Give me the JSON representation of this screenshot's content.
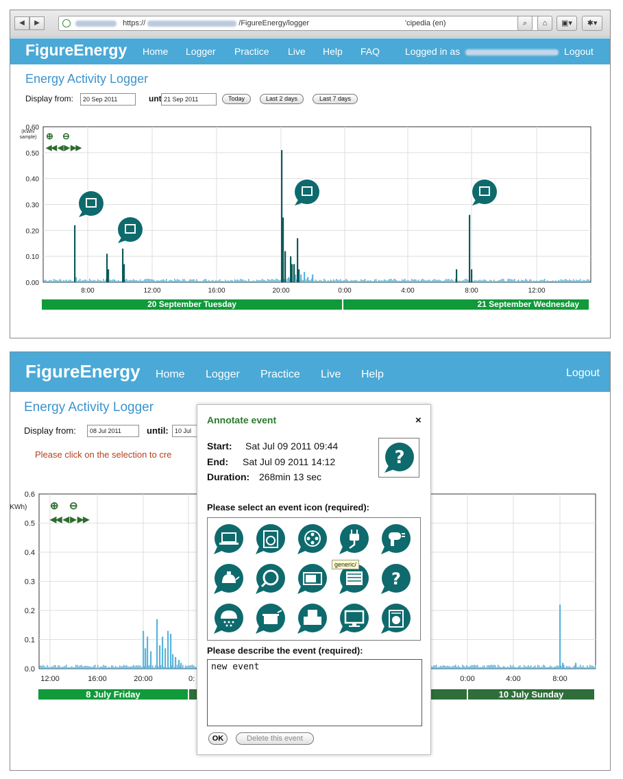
{
  "browser": {
    "url_prefix": "https://",
    "url_path": "/FigureEnergy/logger",
    "search_engine": "'cipedia (en)"
  },
  "site": {
    "brand": "FigureEnergy",
    "nav_top": [
      "Home",
      "Logger",
      "Practice",
      "Live",
      "Help",
      "FAQ"
    ],
    "nav_bottom": [
      "Home",
      "Logger",
      "Practice",
      "Live",
      "Help"
    ],
    "logged_in_prefix": "Logged in as",
    "logout": "Logout",
    "page_title": "Energy Activity Logger",
    "display_from_label": "Display from:",
    "until_label": "until:",
    "colors": {
      "header": "#4aa9d6",
      "title": "#3d93cc",
      "chart_dark": "#0c5a5a",
      "chart_light": "#5ab4dc",
      "day_band_active": "#109a3a",
      "day_band_inactive": "#2f6e3a",
      "icon": "#0e6a6c"
    }
  },
  "top_panel": {
    "from_date": "20 Sep 2011",
    "until_date": "21 Sep 2011",
    "buttons": [
      "Today",
      "Last 2 days",
      "Last 7 days"
    ],
    "y_unit": "(KWh/ sample)",
    "y_ticks": [
      "0.60",
      "0.50",
      "0.40",
      "0.30",
      "0.20",
      "0.10",
      "0.00"
    ],
    "x_ticks": [
      "8:00",
      "12:00",
      "16:00",
      "20:00",
      "0:00",
      "4:00",
      "8:00",
      "12:00"
    ],
    "days": [
      "20 September Tuesday",
      "21 September Wednesday"
    ],
    "annotations": [
      "shower-icon",
      "washing-machine-icon",
      "cooking-pot-icon",
      "shower-icon"
    ]
  },
  "bottom_panel": {
    "from_date": "08 Jul 2011",
    "until_date": "10 Jul",
    "hint": "Please click on the selection to cre",
    "y_unit": "(KWh)",
    "y_ticks": [
      "0.6",
      "0.5",
      "0.4",
      "0.3",
      "0.2",
      "0.1",
      "0.0"
    ],
    "x_ticks_left": [
      "12:00",
      "16:00",
      "20:00",
      "0:"
    ],
    "x_ticks_right": [
      "0:00",
      "4:00",
      "8:00"
    ],
    "days": [
      "8 July Friday",
      "10 July Sunday"
    ]
  },
  "modal": {
    "title": "Annotate event",
    "close": "×",
    "start_label": "Start:",
    "start_value": "Sat Jul 09 2011 09:44",
    "end_label": "End:",
    "end_value": "Sat Jul 09 2011 14:12",
    "duration_label": "Duration:",
    "duration_value": "268min 13 sec",
    "select_icon_label": "Please select an event icon (required):",
    "icons": [
      "laptop-icon",
      "washing-machine-icon",
      "film-reel-icon",
      "plug-icon",
      "hairdryer-icon",
      "kettle-icon",
      "magnifier-icon",
      "microwave-icon",
      "heater-icon",
      "question-icon",
      "shower-icon",
      "cooking-pot-icon",
      "printer-icon",
      "monitor-icon",
      "dryer-icon"
    ],
    "tooltip": "generic/",
    "describe_label": "Please describe the event (required):",
    "description": "new event",
    "ok": "OK",
    "delete": "Delete this event"
  }
}
